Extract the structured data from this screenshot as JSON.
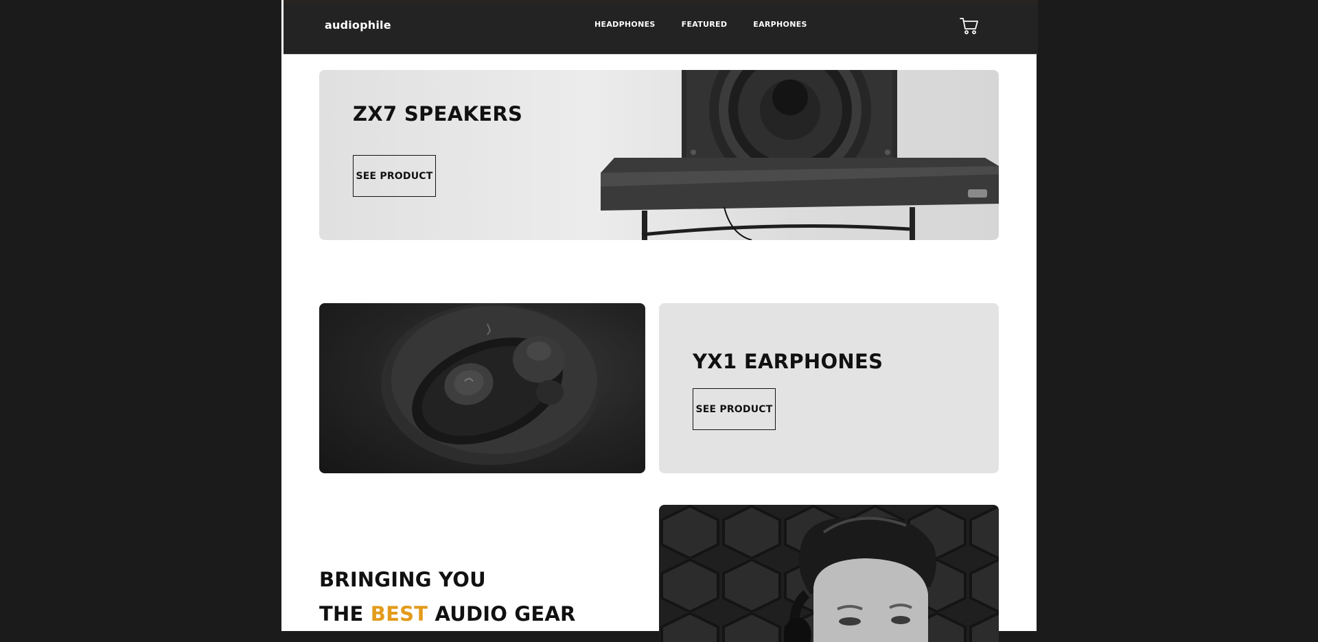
{
  "header": {
    "logo": "audiophile",
    "nav": [
      {
        "label": "HEADPHONES"
      },
      {
        "label": "FEATURED"
      },
      {
        "label": "EARPHONES"
      }
    ],
    "cart_icon": "cart-icon"
  },
  "zx7": {
    "title": "ZX7 SPEAKERS",
    "button": "SEE PRODUCT",
    "image": "speaker-on-table-image"
  },
  "yx1": {
    "title": "YX1 EARPHONES",
    "button": "SEE PRODUCT",
    "image": "earphones-case-image"
  },
  "about": {
    "line1": "BRINGING YOU",
    "line2_pre": "THE ",
    "line2_accent": "BEST",
    "line2_post": " AUDIO GEAR",
    "image": "man-with-headphones-image"
  },
  "colors": {
    "accent": "#e39b1b",
    "header_bg": "#232323",
    "outer_bg": "#1b1b1b"
  }
}
